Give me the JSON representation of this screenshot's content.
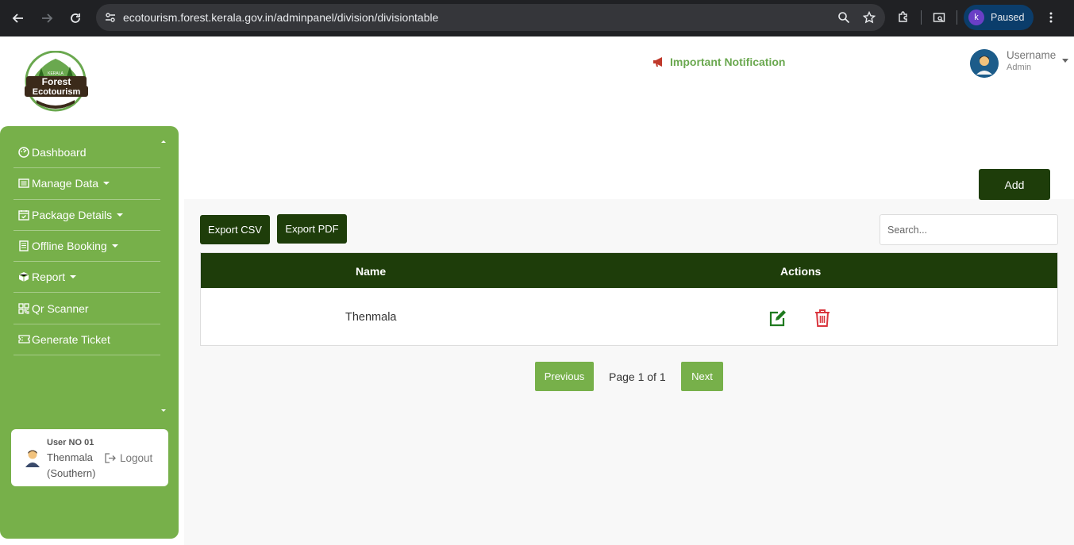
{
  "browser": {
    "url": "ecotourism.forest.kerala.gov.in/adminpanel/division/divisiontable",
    "profile_initial": "k",
    "profile_status": "Paused"
  },
  "header": {
    "logo_text_top": "KERALA",
    "logo_text_1": "Forest",
    "logo_text_2": "Ecotourism",
    "notification_label": "Important Notification",
    "username": "Username",
    "role": "Admin"
  },
  "sidebar": {
    "items": [
      {
        "label": "Dashboard",
        "icon": "dashboard-icon",
        "dropdown": false
      },
      {
        "label": "Manage Data",
        "icon": "list-icon",
        "dropdown": true
      },
      {
        "label": "Package Details",
        "icon": "calendar-check-icon",
        "dropdown": true
      },
      {
        "label": "Offline Booking",
        "icon": "document-icon",
        "dropdown": true
      },
      {
        "label": "Report",
        "icon": "box-icon",
        "dropdown": true
      },
      {
        "label": "Qr Scanner",
        "icon": "qr-icon",
        "dropdown": false
      },
      {
        "label": "Generate Ticket",
        "icon": "ticket-icon",
        "dropdown": false
      }
    ],
    "user_card": {
      "user_no": "User NO 01",
      "location_line1": "Thenmala",
      "location_line2": "(Southern)",
      "logout_label": "Logout"
    }
  },
  "toolbar": {
    "add_label": "Add",
    "export_csv_label": "Export CSV",
    "export_pdf_label": "Export PDF",
    "search_placeholder": "Search..."
  },
  "table": {
    "columns": [
      "Name",
      "Actions"
    ],
    "rows": [
      {
        "name": "Thenmala"
      }
    ]
  },
  "pagination": {
    "previous_label": "Previous",
    "page_info": "Page 1 of 1",
    "next_label": "Next"
  },
  "colors": {
    "sidebar_green": "#77b04a",
    "dark_green": "#1e3d0a",
    "notification_green": "#6aa84f",
    "delete_red": "#d9363e",
    "edit_green": "#1f7a1f"
  }
}
